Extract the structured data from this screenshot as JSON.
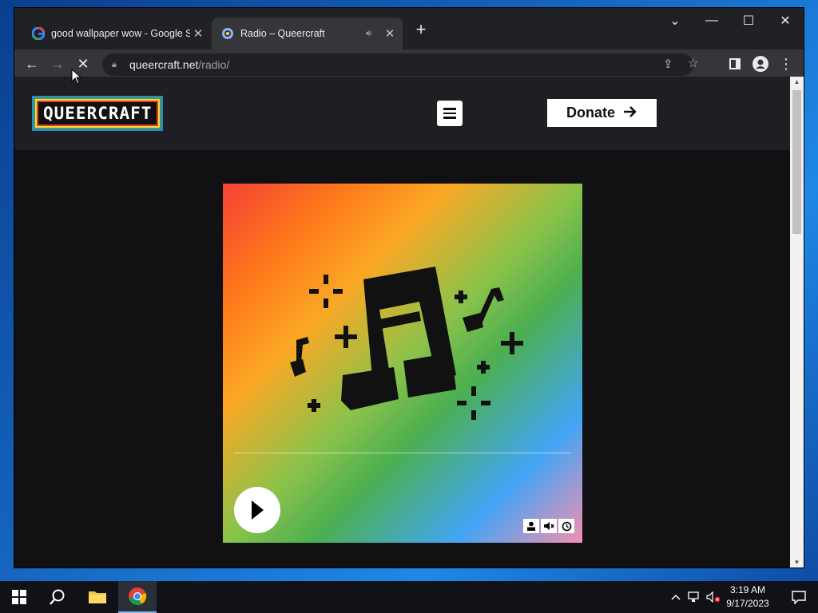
{
  "browser": {
    "tabs": [
      {
        "title": "good wallpaper wow - Google Se",
        "favicon": "google-icon",
        "active": false
      },
      {
        "title": "Radio – Queercraft",
        "favicon": "queercraft-icon",
        "active": true,
        "audio": "speaker-icon"
      }
    ],
    "address": {
      "domain": "queercraft.net",
      "path": "/radio/"
    }
  },
  "site": {
    "logo_text": "QUEERCRAFT",
    "donate_label": "Donate",
    "accent_colors": [
      "#f44336",
      "#ff7a1a",
      "#f9a825",
      "#4caf50",
      "#42a5f5",
      "#f48fb1"
    ]
  },
  "player": {
    "progress_fraction": 0.0,
    "controls": [
      "person-icon",
      "mute-icon",
      "history-icon"
    ]
  },
  "taskbar": {
    "time": "3:19 AM",
    "date": "9/17/2023"
  }
}
